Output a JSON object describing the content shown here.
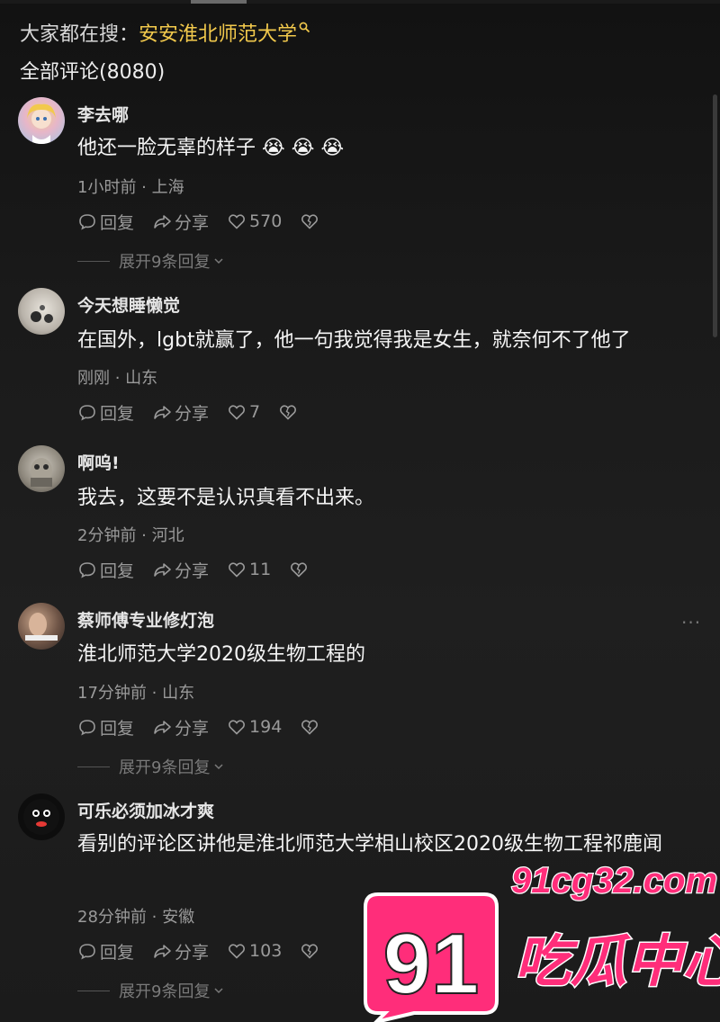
{
  "header": {
    "hot_search_prefix": "大家都在搜：",
    "hot_search_link": "安安淮北师范大学",
    "total_comments": "全部评论(8080)"
  },
  "actions_labels": {
    "reply": "回复",
    "share": "分享"
  },
  "comments": [
    {
      "username": "李去哪",
      "text": "他还一脸无辜的样子",
      "emoji": [
        "😭",
        "😭",
        "😭"
      ],
      "time_location": "1小时前 · 上海",
      "likes": "570",
      "expand": "展开9条回复"
    },
    {
      "username": "今天想睡懒觉",
      "text": "在国外，lgbt就赢了，他一句我觉得我是女生，就奈何不了他了",
      "time_location": "刚刚 · 山东",
      "likes": "7"
    },
    {
      "username": "啊呜!",
      "text": "我去，这要不是认识真看不出来。",
      "time_location": "2分钟前 · 河北",
      "likes": "11"
    },
    {
      "username": "蔡师傅专业修灯泡",
      "text": "淮北师范大学2020级生物工程的",
      "time_location": "17分钟前 · 山东",
      "likes": "194",
      "expand": "展开9条回复",
      "more": "···"
    },
    {
      "username": "可乐必须加冰才爽",
      "text": "看别的评论区讲他是淮北师范大学相山校区2020级生物工程祁鹿闻",
      "time_location": "28分钟前 · 安徽",
      "likes": "103",
      "expand": "展开9条回复"
    }
  ],
  "watermark": {
    "number": "91",
    "domain": "91cg32.com",
    "name": "吃瓜中心"
  },
  "colors": {
    "link": "#f2c94c",
    "watermark_pink": "#ff2d7a",
    "background": "#1a1a1a"
  }
}
